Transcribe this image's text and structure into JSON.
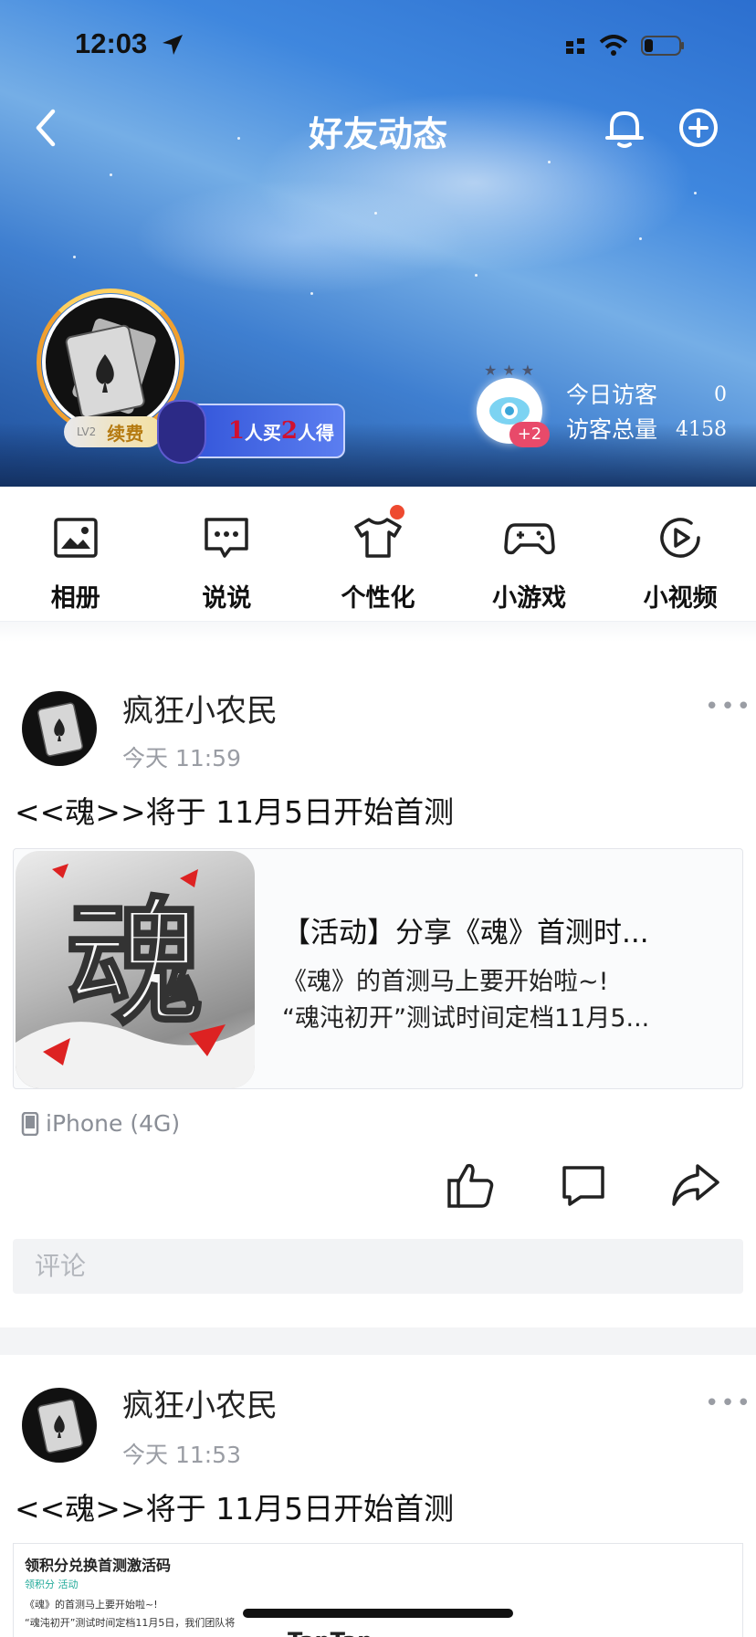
{
  "status_bar": {
    "time": "12:03"
  },
  "nav": {
    "title": "好友动态"
  },
  "profile": {
    "level": "LV2",
    "renew_label": "续费",
    "promo": {
      "first": "1",
      "mid1": "人买",
      "second": "2",
      "mid2": "人得"
    },
    "visitor_plus": "+2",
    "visitors_today_label": "今日访客",
    "visitors_today": "0",
    "visitors_total_label": "访客总量",
    "visitors_total": "4158"
  },
  "features": [
    {
      "label": "相册",
      "icon": "photo-icon"
    },
    {
      "label": "说说",
      "icon": "chat-bubble-icon"
    },
    {
      "label": "个性化",
      "icon": "tshirt-icon"
    },
    {
      "label": "小游戏",
      "icon": "gamepad-icon"
    },
    {
      "label": "小视频",
      "icon": "play-circle-icon"
    }
  ],
  "posts": [
    {
      "author": "疯狂小农民",
      "time": "今天 11:59",
      "text": "<<魂>>将于 11月5日开始首测",
      "card_title": "【活动】分享《魂》首测时...",
      "card_desc_line1": "《魂》的首测马上要开始啦~!",
      "card_desc_line2": "“魂沌初开”测试时间定档11月5...",
      "thumb_glyph": "魂",
      "device": "iPhone (4G)",
      "comment_placeholder": "评论"
    },
    {
      "author": "疯狂小农民",
      "time": "今天 11:53",
      "text": "<<魂>>将于 11月5日开始首测",
      "shot_title": "领积分兑换首测激活码",
      "shot_tags": "领积分    活动",
      "shot_line1": "《魂》的首测马上要开始啦~!",
      "shot_line2": "“魂沌初开”测试时间定档11月5日，我们团队将",
      "shot_brand": "TapTap"
    }
  ],
  "colors": {
    "banner_blue": "#3f87de",
    "accent_red": "#ee4a30",
    "muted_text": "#9a9da4"
  }
}
